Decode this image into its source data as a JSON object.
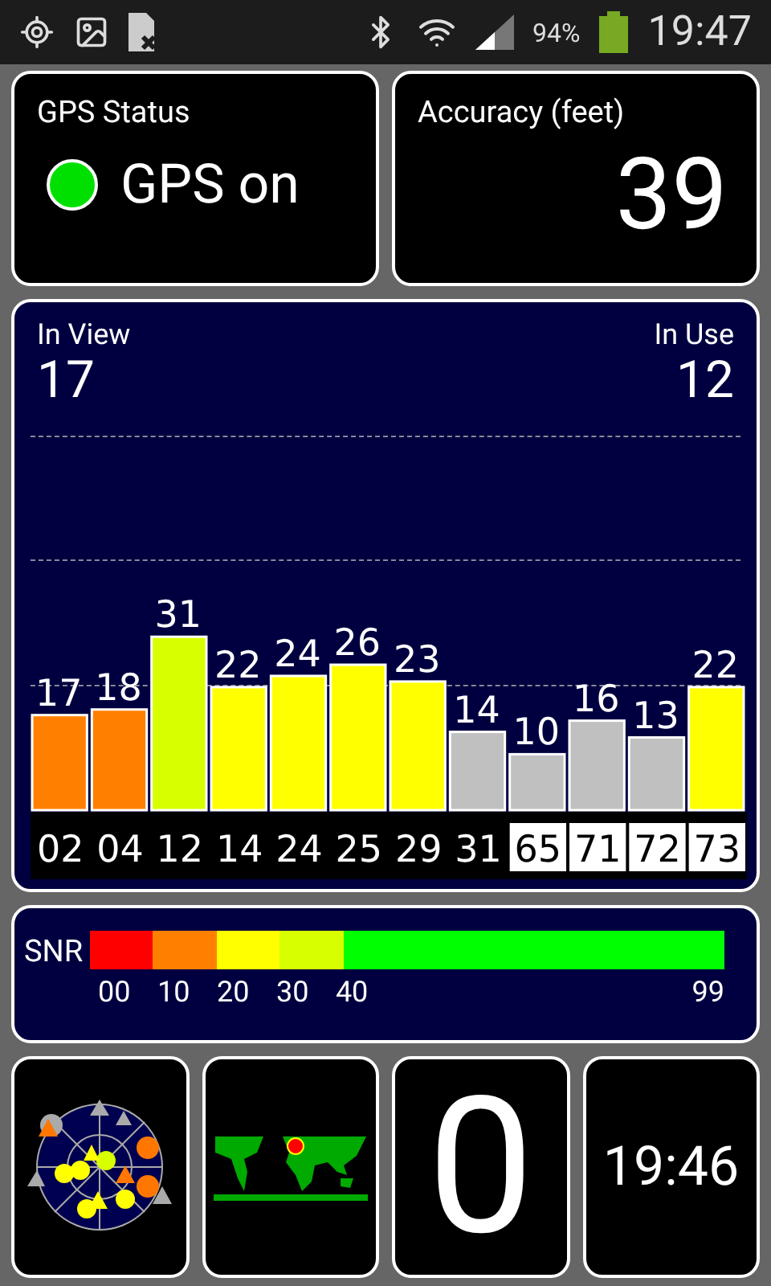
{
  "status_bar": {
    "battery": "94%",
    "time": "19:47"
  },
  "gps_status": {
    "title": "GPS Status",
    "label": "GPS on",
    "on": true
  },
  "accuracy": {
    "title": "Accuracy (feet)",
    "value": "39"
  },
  "satellites_panel": {
    "in_view_label": "In View",
    "in_view": "17",
    "in_use_label": "In Use",
    "in_use": "12",
    "chart_data": {
      "type": "bar",
      "categories": [
        "02",
        "04",
        "12",
        "14",
        "24",
        "25",
        "29",
        "31",
        "65",
        "71",
        "72",
        "73"
      ],
      "values": [
        17,
        18,
        31,
        22,
        24,
        26,
        23,
        14,
        10,
        16,
        13,
        22
      ],
      "data_labels": true
    },
    "satellites": [
      {
        "color": "#ff8000",
        "boxed": false
      },
      {
        "color": "#ff8000",
        "boxed": false
      },
      {
        "color": "#d8ff00",
        "boxed": false
      },
      {
        "color": "#ffff00",
        "boxed": false
      },
      {
        "color": "#ffff00",
        "boxed": false
      },
      {
        "color": "#ffff00",
        "boxed": false
      },
      {
        "color": "#ffff00",
        "boxed": false
      },
      {
        "color": "#c0c0c0",
        "boxed": false
      },
      {
        "color": "#c0c0c0",
        "boxed": true
      },
      {
        "color": "#c0c0c0",
        "boxed": true
      },
      {
        "color": "#c0c0c0",
        "boxed": true
      },
      {
        "color": "#ffff00",
        "boxed": true
      }
    ]
  },
  "snr_legend": {
    "title": "SNR",
    "segments": [
      {
        "label": "00",
        "color": "#ff0000"
      },
      {
        "label": "10",
        "color": "#ff8000"
      },
      {
        "label": "20",
        "color": "#ffff00"
      },
      {
        "label": "30",
        "color": "#d8ff00"
      },
      {
        "label": "40",
        "color": "#00ff00"
      }
    ],
    "end_label": "99"
  },
  "bottom": {
    "counter": "0",
    "time": "19:46"
  }
}
